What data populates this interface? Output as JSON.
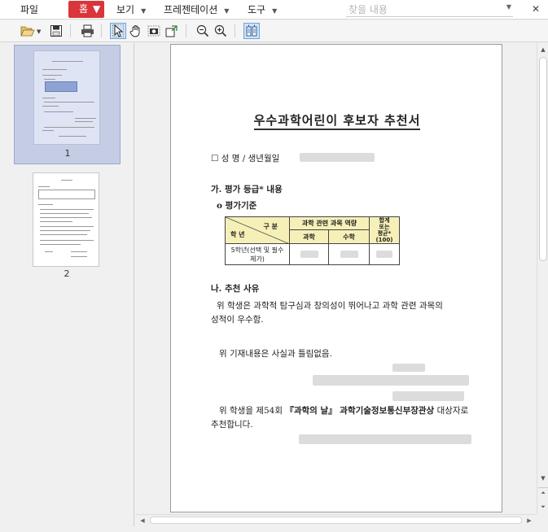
{
  "menu": {
    "file": "파일",
    "home": "홈",
    "view": "보기",
    "presentation": "프레젠테이션",
    "tools": "도구",
    "search_placeholder": "찾을 내용"
  },
  "icons": {
    "open": "folder-open-icon",
    "save": "save-icon",
    "print": "printer-icon",
    "select": "cursor-icon",
    "hand": "hand-icon",
    "snapshot": "camera-icon",
    "fit": "fit-page-icon",
    "zoom_out": "zoom-out-icon",
    "zoom_in": "zoom-in-icon",
    "two_page": "columns-icon"
  },
  "thumbnails": [
    {
      "label": "1",
      "selected": true
    },
    {
      "label": "2",
      "selected": false
    }
  ],
  "document": {
    "title": "우수과학어린이 후보자 추천서",
    "name_label": "☐ 성 명 / 생년월일",
    "section_a": "가. 평가 등급* 내용",
    "criteria": "o  평가기준",
    "table": {
      "division": "구  분",
      "grade": "학  년",
      "competency": "과학 관련 과목 역량",
      "science": "과학",
      "math": "수학",
      "total_line1": "합계",
      "total_line2": "또는",
      "total_line3": "평균*",
      "total_line4": "(100)",
      "row_line1": "5학년(선택 및 필수",
      "row_line2": "제가)"
    },
    "section_b": "나. 추천 사유",
    "reason_line1": "위 학생은 과학적 탐구심과 창의성이 뛰어나고 과학 관련 과목의",
    "reason_line2": "성적이 우수함.",
    "confirm": "위 기재내용은 사실과 틀림없음.",
    "recommend_pre": "위  학생을  제54회",
    "recommend_bold": "『과학의 날』 과학기술정보통신부장관상",
    "recommend_post": "대상자로",
    "recommend_line2": "추천합니다."
  },
  "colors": {
    "home_button": "#d9353b",
    "table_header": "#f6f0b8",
    "thumb_selected": "#c5cde4"
  }
}
